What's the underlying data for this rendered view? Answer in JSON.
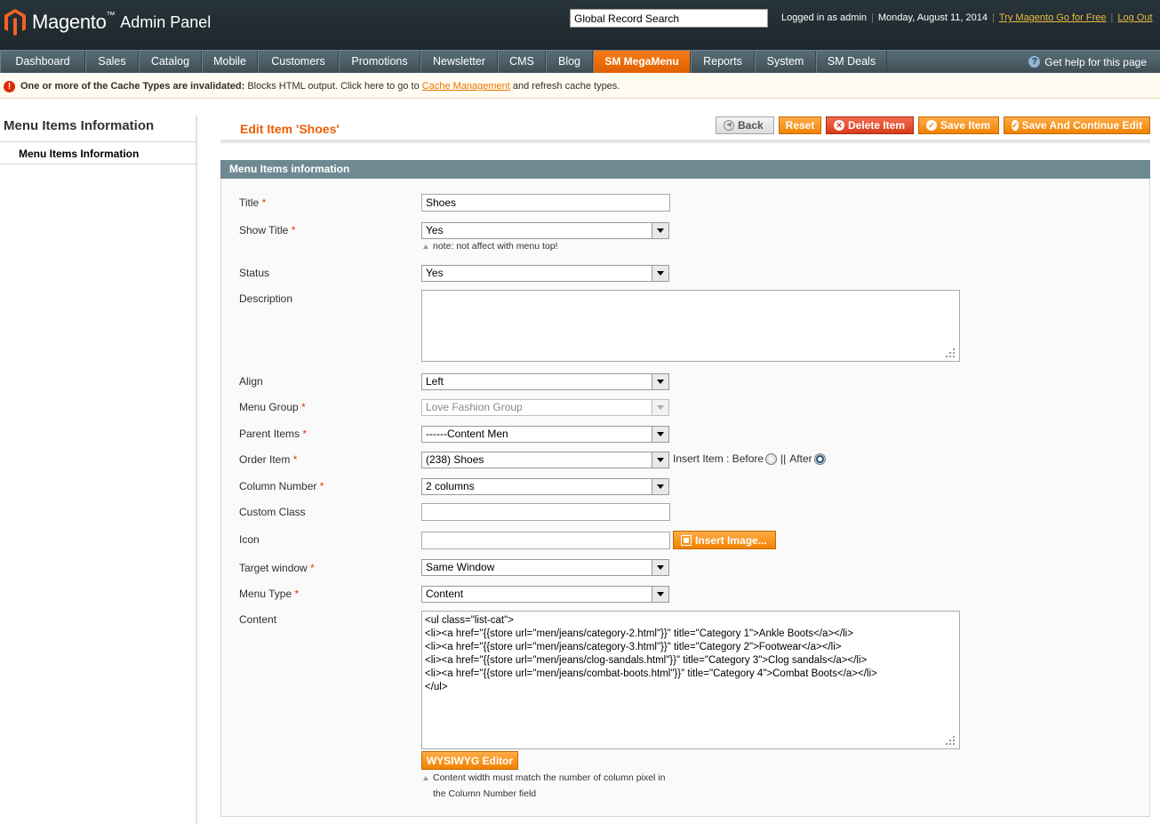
{
  "header": {
    "brand": "Magento",
    "brand_reg": "™",
    "brand_sub": "Admin Panel",
    "search_value": "Global Record Search",
    "logged_in": "Logged in as admin",
    "date": "Monday, August 11, 2014",
    "try_link": "Try Magento Go for Free",
    "logout": "Log Out"
  },
  "nav": {
    "items": [
      "Dashboard",
      "Sales",
      "Catalog",
      "Mobile",
      "Customers",
      "Promotions",
      "Newsletter",
      "CMS",
      "Blog",
      "SM MegaMenu",
      "Reports",
      "System",
      "SM Deals"
    ],
    "help": "Get help for this page"
  },
  "notice": {
    "bold": "One or more of the Cache Types are invalidated:",
    "text1": " Blocks HTML output. Click here to go to ",
    "link": "Cache Management",
    "text2": " and refresh cache types."
  },
  "side": {
    "title": "Menu Items Information",
    "tab": "Menu Items Information"
  },
  "page": {
    "title": "Edit Item 'Shoes'",
    "buttons": {
      "back": "Back",
      "reset": "Reset",
      "delete": "Delete Item",
      "save": "Save Item",
      "save_continue": "Save And Continue Edit"
    }
  },
  "form": {
    "fieldset_title": "Menu Items information",
    "required_mark": "*",
    "title": {
      "label": "Title",
      "value": "Shoes"
    },
    "show_title": {
      "label": "Show Title",
      "value": "Yes",
      "note": "note: not affect with menu top!"
    },
    "status": {
      "label": "Status",
      "value": "Yes"
    },
    "description": {
      "label": "Description",
      "value": ""
    },
    "align": {
      "label": "Align",
      "value": "Left"
    },
    "menu_group": {
      "label": "Menu Group",
      "value": "Love Fashion Group"
    },
    "parent_items": {
      "label": "Parent Items",
      "value": "------Content Men"
    },
    "order_item": {
      "label": "Order Item",
      "value": "(238) Shoes",
      "insert_label": "Insert Item : Before",
      "separator": "||",
      "after_label": "After"
    },
    "column_number": {
      "label": "Column Number",
      "value": "2 columns"
    },
    "custom_class": {
      "label": "Custom Class",
      "value": ""
    },
    "icon": {
      "label": "Icon",
      "value": "",
      "insert_image": "Insert Image..."
    },
    "target_window": {
      "label": "Target window",
      "value": "Same Window"
    },
    "menu_type": {
      "label": "Menu Type",
      "value": "Content"
    },
    "content": {
      "label": "Content",
      "value": "<ul class=\"list-cat\">\n<li><a href=\"{{store url=\"men/jeans/category-2.html\"}}\" title=\"Category 1\">Ankle Boots</a></li>\n<li><a href=\"{{store url=\"men/jeans/category-3.html\"}}\" title=\"Category 2\">Footwear</a></li>\n<li><a href=\"{{store url=\"men/jeans/clog-sandals.html\"}}\" title=\"Category 3\">Clog sandals</a></li>\n<li><a href=\"{{store url=\"men/jeans/combat-boots.html\"}}\" title=\"Category 4\">Combat Boots</a></li>\n</ul>",
      "wysiwyg": "WYSIWYG Editor",
      "note_line1": "Content width must match the number of column pixel in",
      "note_line2": "the Column Number field"
    }
  },
  "colors": {
    "accent": "#eb5e00",
    "nav_active": "#f77c16",
    "fieldset_head": "#6f8992",
    "required": "#eb340a"
  }
}
